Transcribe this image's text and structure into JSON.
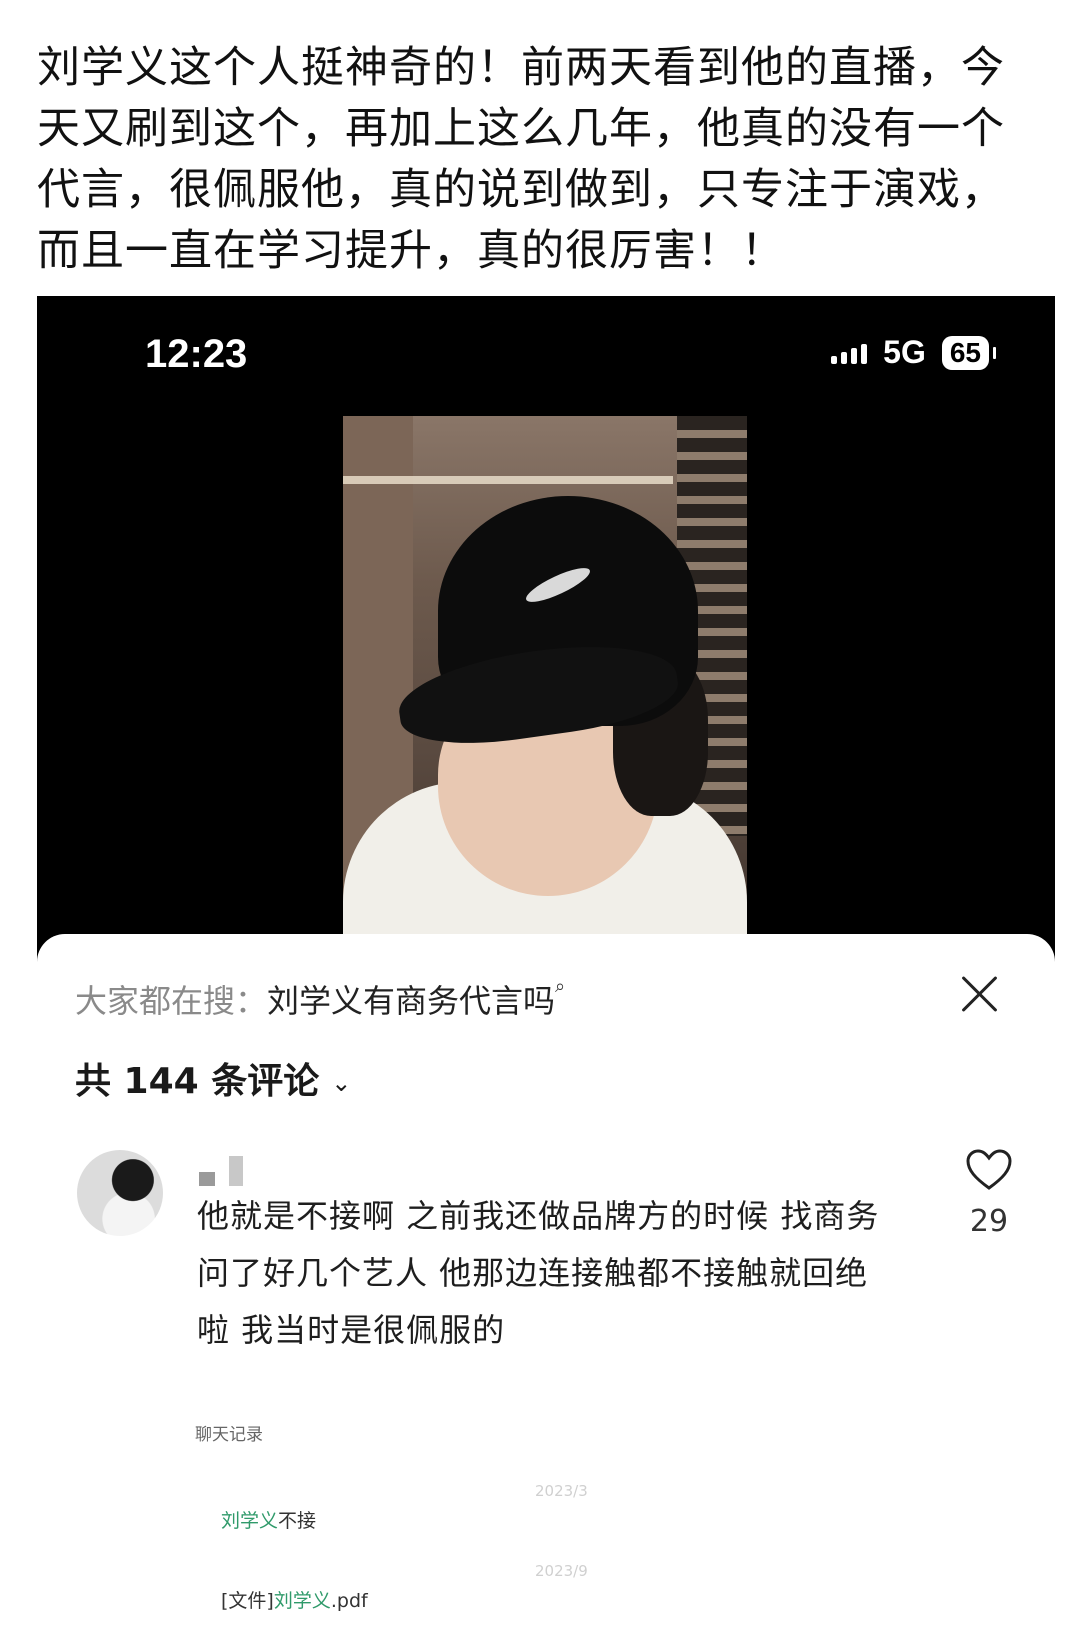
{
  "post": {
    "text": "刘学义这个人挺神奇的！前两天看到他的直播，今天又刷到这个，再加上这么几年，他真的没有一个代言，很佩服他，真的说到做到，只专注于演戏，而且一直在学习提升，真的很厉害！！"
  },
  "status_bar": {
    "time": "12:23",
    "network": "5G",
    "battery": "65"
  },
  "comments_sheet": {
    "search_label": "大家都在搜：",
    "search_query": "刘学义有商务代言吗",
    "count_label": "共 144 条评论",
    "comment": {
      "text": "他就是不接啊 之前我还做品牌方的时候 找商务问了好几个艺人 他那边连接触都不接触就回绝啦 我当时是很佩服的",
      "likes": "29"
    }
  },
  "chat_record": {
    "title": "聊天记录",
    "date1": "2023/3",
    "msg1_highlight": "刘学义",
    "msg1_rest": "不接",
    "date2": "2023/9",
    "msg2_prefix": "[文件]",
    "msg2_highlight": "刘学义",
    "msg2_suffix": ".pdf"
  }
}
